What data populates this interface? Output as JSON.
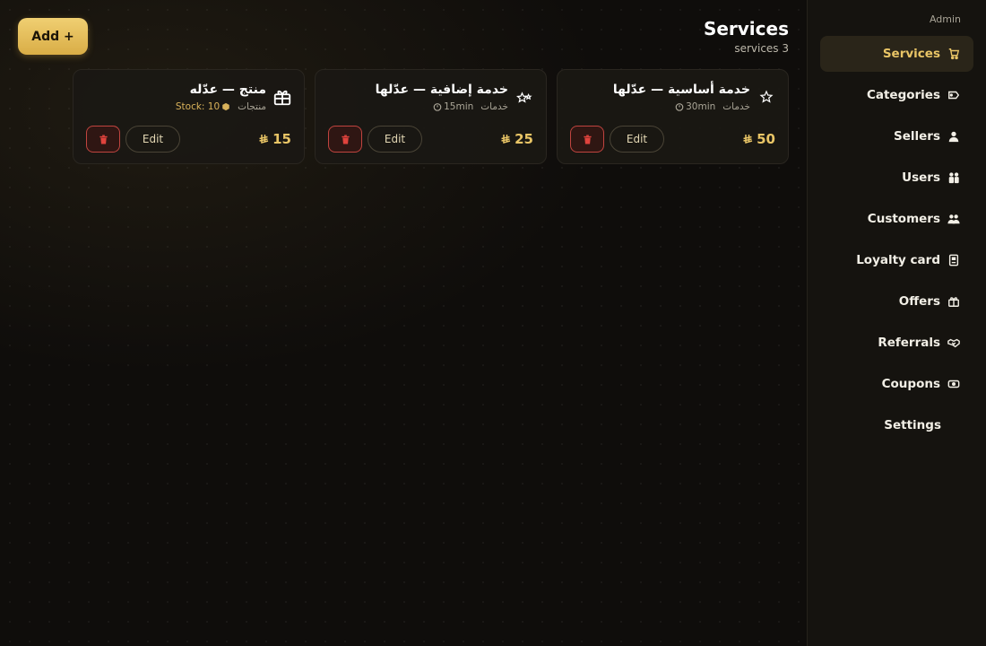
{
  "header": {
    "title": "Services",
    "subtitle": "services 3"
  },
  "toolbar": {
    "add_label": "Add +"
  },
  "sidebar": {
    "role": "Admin",
    "items": [
      {
        "label": "Services",
        "icon": "cart-icon",
        "active": true
      },
      {
        "label": "Categories",
        "icon": "tag-icon"
      },
      {
        "label": "Sellers",
        "icon": "person-icon"
      },
      {
        "label": "Users",
        "icon": "users-icon"
      },
      {
        "label": "Customers",
        "icon": "people-icon"
      },
      {
        "label": "Loyalty card",
        "icon": "card-icon"
      },
      {
        "label": "Offers",
        "icon": "gift-icon"
      },
      {
        "label": "Referrals",
        "icon": "handshake-icon"
      },
      {
        "label": "Coupons",
        "icon": "ticket-icon"
      },
      {
        "label": "Settings"
      }
    ]
  },
  "cards": [
    {
      "icon": "star-icon",
      "title": "خدمة أساسية — عدّلها",
      "category": "خدمات",
      "detail": "30min",
      "detail_icon": "timer-icon",
      "price": "50",
      "edit_label": "Edit"
    },
    {
      "icon": "sparkle-stars-icon",
      "title": "خدمة إضافية — عدّلها",
      "category": "خدمات",
      "detail": "15min",
      "detail_icon": "timer-icon",
      "price": "25",
      "edit_label": "Edit"
    },
    {
      "icon": "gift-box-icon",
      "title": "منتج — عدّله",
      "category": "منتجات",
      "detail": "Stock: 10",
      "detail_icon": "box-icon",
      "price": "15",
      "edit_label": "Edit"
    }
  ],
  "colors": {
    "accent": "#e9c566",
    "background": "#0f0d0b",
    "danger": "#c0443f"
  }
}
